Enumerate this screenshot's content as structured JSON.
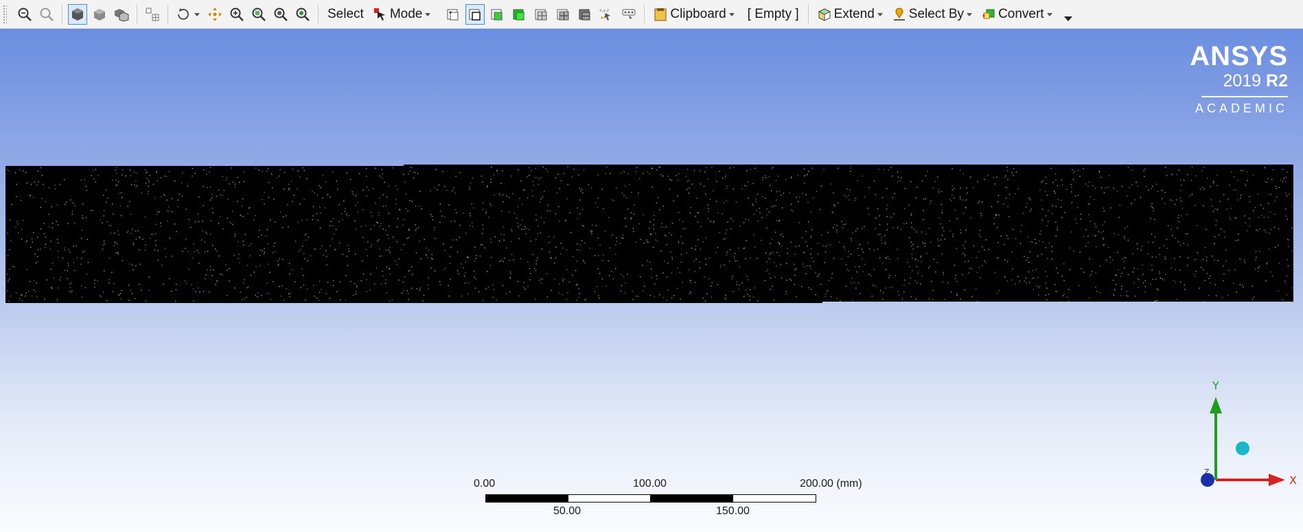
{
  "toolbar": {
    "select_label": "Select",
    "mode_label": "Mode",
    "clipboard_label": "Clipboard",
    "clipboard_state": "[ Empty ]",
    "extend_label": "Extend",
    "select_by_label": "Select By",
    "convert_label": "Convert",
    "axis_icon_text": "x,y,z",
    "icons_left": [
      "zoom-in-icon",
      "zoom-out-icon",
      "solid-view-icon",
      "shaded-view-icon",
      "cube-view-icon",
      "layout-icon",
      "rotate-icon",
      "pan-icon",
      "zoom-fit-icon",
      "zoom-box-icon",
      "zoom-region-icon",
      "magnify-icon"
    ],
    "icons_mode": [
      "select-vertex-icon",
      "select-edge-icon",
      "select-face-icon",
      "select-body-icon",
      "select-face-set-icon",
      "select-body-set-icon",
      "select-volume-icon",
      "coordinate-select-icon",
      "select-filter-icon"
    ]
  },
  "viewport": {
    "logo": {
      "brand": "ANSYS",
      "year": "2019",
      "release": "R2",
      "edition": "ACADEMIC"
    },
    "triad": {
      "x": "X",
      "y": "Y",
      "z": "Z"
    },
    "scale": {
      "top_labels": [
        "0.00",
        "100.00",
        "200.00 (mm)"
      ],
      "bottom_labels": [
        "50.00",
        "150.00"
      ]
    },
    "colors": {
      "body": "#000000",
      "x_axis": "#d62424",
      "y_axis": "#1f9d1f",
      "z_axis": "#1a2fa8",
      "iso_ball": "#1ab7c9"
    }
  }
}
